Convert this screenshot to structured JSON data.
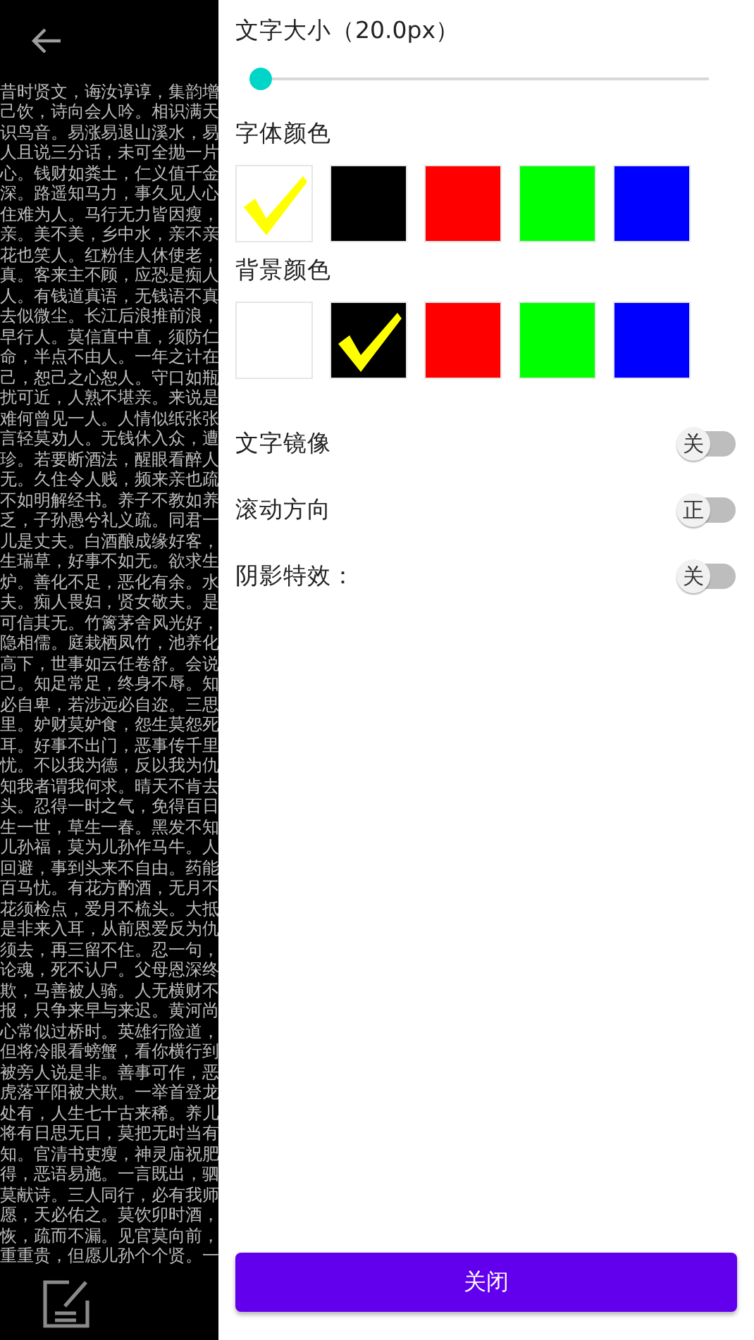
{
  "reader": {
    "lines": [
      "昔时贤文，诲汝谆谆，集韵增",
      "己饮，诗向会人吟。相识满天",
      "识鸟音。易涨易退山溪水，易",
      "人且说三分话，未可全抛一片",
      "心。钱财如粪土，仁义值千金",
      "深。路遥知马力，事久见人心",
      "住难为人。马行无力皆因瘦，",
      "亲。美不美，乡中水，亲不亲",
      "花也笑人。红粉佳人休使老，",
      "真。客来主不顾，应恐是痴人",
      "人。有钱道真语，无钱语不真",
      "去似微尘。长江后浪推前浪，",
      "早行人。莫信直中直，须防仁",
      "命，半点不由人。一年之计在",
      "己，恕己之心恕人。守口如瓶",
      "扰可近，人熟不堪亲。来说是",
      "难何曾见一人。人情似纸张张",
      "言轻莫劝人。无钱休入众，遭",
      "珍。若要断酒法，醒眼看醉人",
      "无。久住令人贱，频来亲也疏",
      "不如明解经书。养子不教如养",
      "乏，子孙愚兮礼义疏。同君一",
      "儿是丈夫。白酒酿成缘好客，",
      "生瑞草，好事不如无。欲求生",
      "炉。善化不足，恶化有余。水",
      "夫。痴人畏妇，贤女敬夫。是",
      "可信其无。竹篱茅舍风光好，",
      "隐相儒。庭栽栖凤竹，池养化",
      "高下，世事如云任卷舒。会说",
      "己。知足常足，终身不辱。知",
      "必自卑，若涉远必自迩。三思",
      "里。妒财莫妒食，怨生莫怨死",
      "耳。好事不出门，恶事传千里",
      "忧。不以我为德，反以我为仇",
      "知我者谓我何求。晴天不肯去",
      "头。忍得一时之气，免得百日",
      "生一世，草生一春。黑发不知",
      "儿孙福，莫为儿孙作马牛。人",
      "回避，事到头来不自由。药能",
      "百马忧。有花方酌酒，无月不",
      "花须检点，爱月不梳头。大抵",
      "是非来入耳，从前恩爱反为仇",
      "须去，再三留不住。忍一句，",
      "论魂，死不认尸。父母恩深终",
      "欺，马善被人骑。人无横财不",
      "报，只争来早与来迟。黄河尚",
      "心常似过桥时。英雄行险道，",
      "但将冷眼看螃蟹，看你横行到",
      "被旁人说是非。善事可作，恶",
      "虎落平阳被犬欺。一举首登龙",
      "处有，人生七十古来稀。养儿",
      "将有日思无日，莫把无时当有",
      "知。官清书吏瘦，神灵庙祝肥",
      "得，恶语易施。一言既出，驷",
      "莫献诗。三人同行，必有我师",
      "愿，天必佑之。莫饮卯时酒，",
      "恢，疏而不漏。见官莫向前，",
      "重重贵，但愿儿孙个个贤。一"
    ]
  },
  "settings": {
    "font_size": {
      "label": "文字大小（20.0px）",
      "level": 0
    },
    "font_color": {
      "label": "字体颜色",
      "swatches": [
        {
          "color": "#ffffff",
          "selected": true
        },
        {
          "color": "#000000",
          "selected": false
        },
        {
          "color": "#ff0000",
          "selected": false
        },
        {
          "color": "#00ff00",
          "selected": false
        },
        {
          "color": "#0000ff",
          "selected": false
        }
      ]
    },
    "background_color": {
      "label": "背景颜色",
      "swatches": [
        {
          "color": "#ffffff",
          "selected": false
        },
        {
          "color": "#000000",
          "selected": true
        },
        {
          "color": "#ff0000",
          "selected": false
        },
        {
          "color": "#00ff00",
          "selected": false
        },
        {
          "color": "#0000ff",
          "selected": false
        }
      ]
    },
    "toggles": [
      {
        "label": "文字镜像",
        "state": "关",
        "on": false
      },
      {
        "label": "滚动方向",
        "state": "正",
        "on": false
      },
      {
        "label": "阴影特效：",
        "state": "关",
        "on": false
      }
    ],
    "close_button": "关闭"
  }
}
